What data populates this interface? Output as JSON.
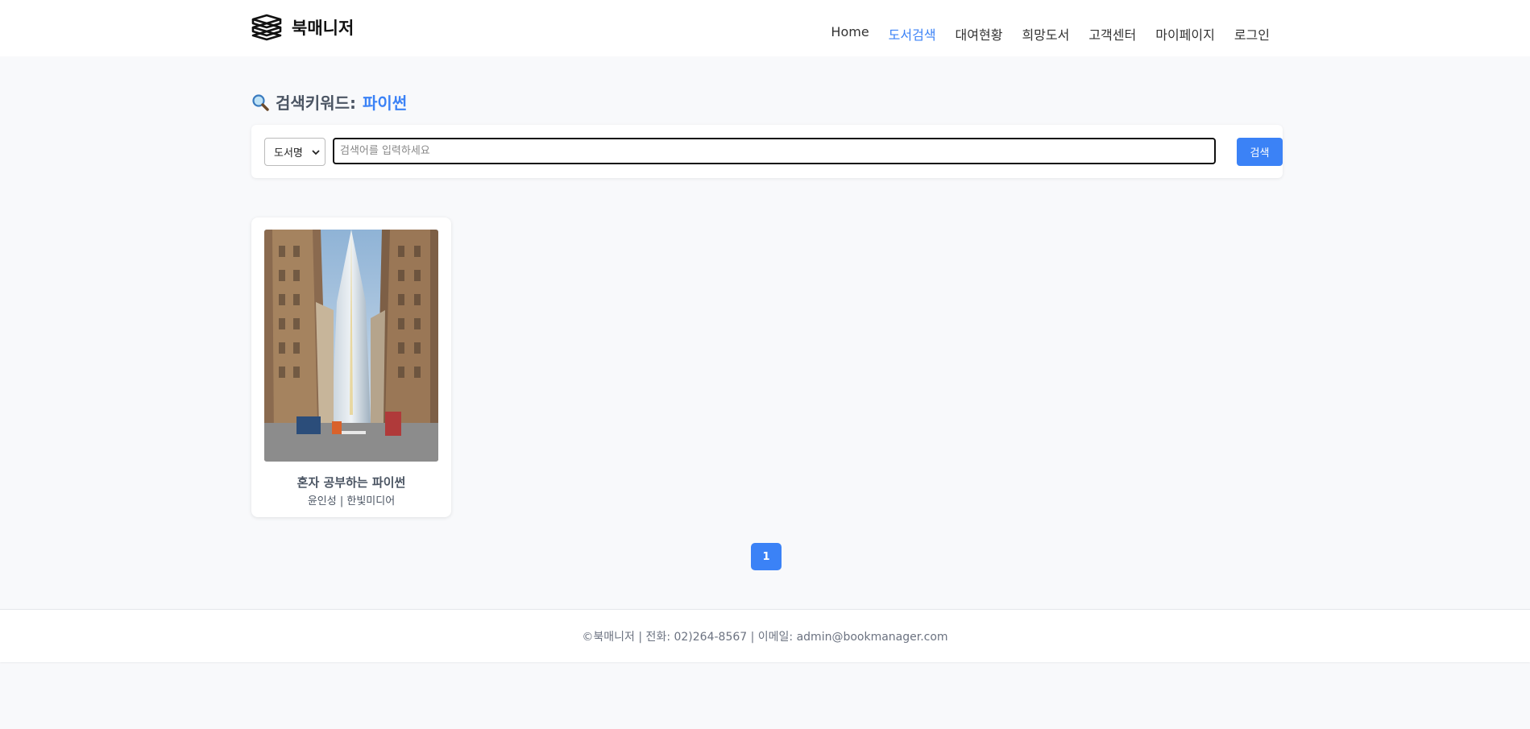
{
  "header": {
    "logo_text": "북매니저",
    "logo_icon": "books-stack-icon",
    "nav": [
      {
        "label": "Home",
        "active": false
      },
      {
        "label": "도서검색",
        "active": true
      },
      {
        "label": "대여현황",
        "active": false
      },
      {
        "label": "희망도서",
        "active": false
      },
      {
        "label": "고객센터",
        "active": false
      },
      {
        "label": "마이페이지",
        "active": false
      },
      {
        "label": "로그인",
        "active": false
      }
    ]
  },
  "search": {
    "title_label": "검색키워드:",
    "keyword": "파이썬",
    "title_icon": "magnifier-icon",
    "select_value": "도서명",
    "input_placeholder": "검색어를 입력하세요",
    "input_value": "",
    "button_label": "검색"
  },
  "results": [
    {
      "title": "혼자 공부하는 파이썬",
      "meta": "윤인성 | 한빛미디어"
    }
  ],
  "pagination": {
    "current": "1"
  },
  "footer": {
    "text": "©북매니저 | 전화: 02)264-8567 | 이메일: admin@bookmanager.com"
  },
  "colors": {
    "accent": "#3b82f6",
    "background": "#f8f9fb",
    "card": "#ffffff"
  }
}
